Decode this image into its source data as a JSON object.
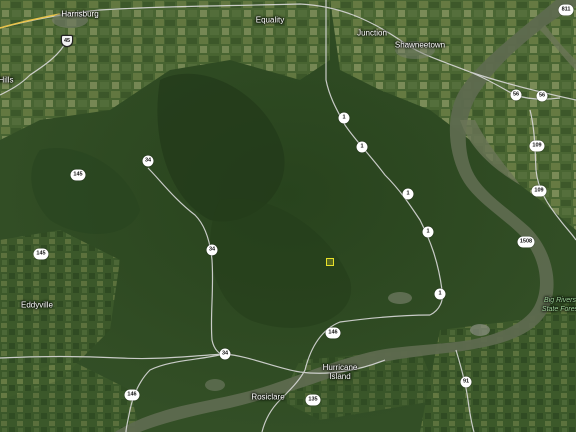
{
  "map": {
    "colors": {
      "forest": "#2e4a22",
      "forest_dark": "#243d1b",
      "farmland": "#4f6b36",
      "field_light": "#8c9a5e",
      "river": "#5e6a4f",
      "road": "#d9d9d9",
      "interstate": "#e8c34a",
      "marker": "#e9e12a"
    },
    "towns": [
      {
        "id": "harrisburg",
        "label": "Harrisburg"
      },
      {
        "id": "equality",
        "label": "Equality"
      },
      {
        "id": "junction",
        "label": "Junction"
      },
      {
        "id": "shawneetown",
        "label": "Shawneetown"
      },
      {
        "id": "hills",
        "label": "Hills"
      },
      {
        "id": "eddyville",
        "label": "Eddyville"
      },
      {
        "id": "hurricane",
        "label": "Hurricane\nIsland"
      },
      {
        "id": "rosiclare",
        "label": "Rosiclare"
      },
      {
        "id": "bigrivers",
        "label": "Big Rivers\nState Fores"
      }
    ],
    "shields": [
      {
        "id": "s45",
        "label": "45"
      },
      {
        "id": "s811",
        "label": "811"
      },
      {
        "id": "s1a",
        "label": "1"
      },
      {
        "id": "s1b",
        "label": "1"
      },
      {
        "id": "s1c",
        "label": "1"
      },
      {
        "id": "s1d",
        "label": "1"
      },
      {
        "id": "s1e",
        "label": "1"
      },
      {
        "id": "s56a",
        "label": "56"
      },
      {
        "id": "s56b",
        "label": "56"
      },
      {
        "id": "s109a",
        "label": "109"
      },
      {
        "id": "s109b",
        "label": "109"
      },
      {
        "id": "s1508",
        "label": "1508"
      },
      {
        "id": "s34a",
        "label": "34"
      },
      {
        "id": "s34b",
        "label": "34"
      },
      {
        "id": "s34c",
        "label": "34"
      },
      {
        "id": "s145a",
        "label": "145"
      },
      {
        "id": "s145b",
        "label": "145"
      },
      {
        "id": "s146a",
        "label": "146"
      },
      {
        "id": "s146b",
        "label": "146"
      },
      {
        "id": "s91",
        "label": "91"
      },
      {
        "id": "s135",
        "label": "135"
      }
    ]
  }
}
